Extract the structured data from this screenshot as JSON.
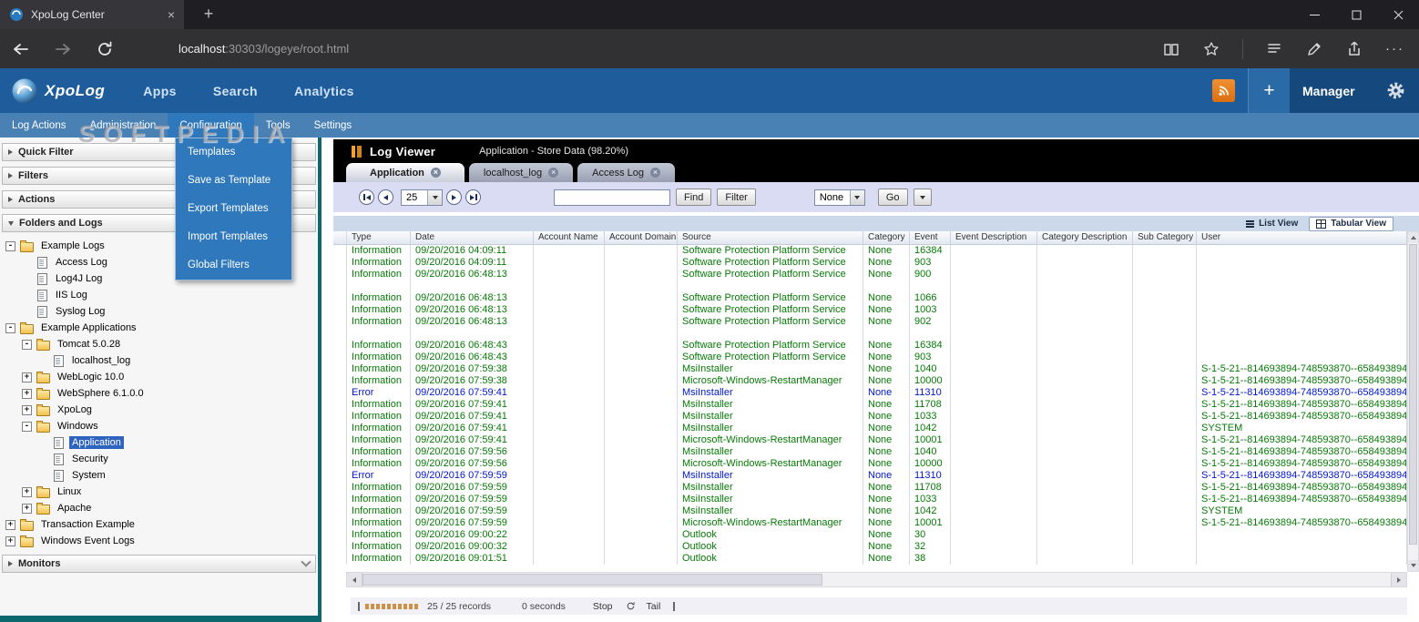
{
  "browser": {
    "tab_title": "XpoLog Center",
    "url_host": "localhost",
    "url_rest": ":30303/logeye/root.html"
  },
  "app_header": {
    "brand": "XpoLog",
    "nav": [
      "Apps",
      "Search",
      "Analytics"
    ],
    "add_label": "+",
    "manager_label": "Manager"
  },
  "menu_bar": {
    "items": [
      "Log Actions",
      "Administration",
      "Configuration",
      "Tools",
      "Settings"
    ],
    "active": "Configuration"
  },
  "config_menu": {
    "items": [
      "Templates",
      "Save as Template",
      "Export Templates",
      "Import Templates",
      "Global Filters"
    ]
  },
  "watermark": "SOFTPEDIA",
  "sidebar": {
    "sections": [
      "Quick Filter",
      "Filters",
      "Actions",
      "Folders and Logs",
      "Monitors"
    ],
    "tree": [
      {
        "label": "Example Logs",
        "level": 0,
        "type": "folder",
        "expander": "minus"
      },
      {
        "label": "Access Log",
        "level": 1,
        "type": "log"
      },
      {
        "label": "Log4J Log",
        "level": 1,
        "type": "log"
      },
      {
        "label": "IIS Log",
        "level": 1,
        "type": "log"
      },
      {
        "label": "Syslog Log",
        "level": 1,
        "type": "log"
      },
      {
        "label": "Example Applications",
        "level": 0,
        "type": "folder",
        "expander": "minus"
      },
      {
        "label": "Tomcat 5.0.28",
        "level": 1,
        "type": "folder",
        "expander": "minus"
      },
      {
        "label": "localhost_log",
        "level": 2,
        "type": "log"
      },
      {
        "label": "WebLogic 10.0",
        "level": 1,
        "type": "folder",
        "expander": "plus"
      },
      {
        "label": "WebSphere 6.1.0.0",
        "level": 1,
        "type": "folder",
        "expander": "plus"
      },
      {
        "label": "XpoLog",
        "level": 1,
        "type": "folder",
        "expander": "plus"
      },
      {
        "label": "Windows",
        "level": 1,
        "type": "folder",
        "expander": "minus"
      },
      {
        "label": "Application",
        "level": 2,
        "type": "log",
        "selected": true
      },
      {
        "label": "Security",
        "level": 2,
        "type": "log"
      },
      {
        "label": "System",
        "level": 2,
        "type": "log"
      },
      {
        "label": "Linux",
        "level": 1,
        "type": "folder",
        "expander": "plus"
      },
      {
        "label": "Apache",
        "level": 1,
        "type": "folder",
        "expander": "plus"
      },
      {
        "label": "Transaction Example",
        "level": 0,
        "type": "folder",
        "expander": "plus"
      },
      {
        "label": "Windows Event Logs",
        "level": 0,
        "type": "folder",
        "expander": "plus"
      }
    ]
  },
  "log_viewer": {
    "title": "Log Viewer",
    "subtitle": "Application  - Store Data (98.20%)",
    "tabs": [
      {
        "label": "Application",
        "active": true
      },
      {
        "label": "localhost_log",
        "active": false
      },
      {
        "label": "Access Log",
        "active": false
      }
    ],
    "toolbar": {
      "page_size": "25",
      "find_label": "Find",
      "filter_label": "Filter",
      "filter_select": "None",
      "go_label": "Go"
    },
    "view_toggle": {
      "list": "List View",
      "tabular": "Tabular View"
    },
    "table": {
      "columns": [
        "Type",
        "Date",
        "Account Name",
        "Account Domain",
        "Source",
        "Category",
        "Event",
        "Event Description",
        "Category Description",
        "Sub Category",
        "User"
      ],
      "rows": [
        {
          "sev": "info",
          "cells": [
            "Information",
            "09/20/2016 04:09:11",
            "",
            "",
            "Software Protection Platform Service",
            "None",
            "16384",
            "",
            "",
            "",
            ""
          ]
        },
        {
          "sev": "info",
          "cells": [
            "Information",
            "09/20/2016 04:09:11",
            "",
            "",
            "Software Protection Platform Service",
            "None",
            "903",
            "",
            "",
            "",
            ""
          ]
        },
        {
          "sev": "info",
          "cells": [
            "Information",
            "09/20/2016 06:48:13",
            "",
            "",
            "Software Protection Platform Service",
            "None",
            "900",
            "",
            "",
            "",
            ""
          ]
        },
        {
          "sev": "blank",
          "cells": []
        },
        {
          "sev": "info",
          "cells": [
            "Information",
            "09/20/2016 06:48:13",
            "",
            "",
            "Software Protection Platform Service",
            "None",
            "1066",
            "",
            "",
            "",
            ""
          ]
        },
        {
          "sev": "info",
          "cells": [
            "Information",
            "09/20/2016 06:48:13",
            "",
            "",
            "Software Protection Platform Service",
            "None",
            "1003",
            "",
            "",
            "",
            ""
          ]
        },
        {
          "sev": "info",
          "cells": [
            "Information",
            "09/20/2016 06:48:13",
            "",
            "",
            "Software Protection Platform Service",
            "None",
            "902",
            "",
            "",
            "",
            ""
          ]
        },
        {
          "sev": "blank",
          "cells": []
        },
        {
          "sev": "info",
          "cells": [
            "Information",
            "09/20/2016 06:48:43",
            "",
            "",
            "Software Protection Platform Service",
            "None",
            "16384",
            "",
            "",
            "",
            ""
          ]
        },
        {
          "sev": "info",
          "cells": [
            "Information",
            "09/20/2016 06:48:43",
            "",
            "",
            "Software Protection Platform Service",
            "None",
            "903",
            "",
            "",
            "",
            ""
          ]
        },
        {
          "sev": "info",
          "cells": [
            "Information",
            "09/20/2016 07:59:38",
            "",
            "",
            "MsiInstaller",
            "None",
            "1040",
            "",
            "",
            "",
            "S-1-5-21--814693894-748593870--658493894"
          ]
        },
        {
          "sev": "info",
          "cells": [
            "Information",
            "09/20/2016 07:59:38",
            "",
            "",
            "Microsoft-Windows-RestartManager",
            "None",
            "10000",
            "",
            "",
            "",
            "S-1-5-21--814693894-748593870--658493894"
          ]
        },
        {
          "sev": "error",
          "cells": [
            "Error",
            "09/20/2016 07:59:41",
            "",
            "",
            "MsiInstaller",
            "None",
            "11310",
            "",
            "",
            "",
            "S-1-5-21--814693894-748593870--658493894"
          ]
        },
        {
          "sev": "info",
          "cells": [
            "Information",
            "09/20/2016 07:59:41",
            "",
            "",
            "MsiInstaller",
            "None",
            "11708",
            "",
            "",
            "",
            "S-1-5-21--814693894-748593870--658493894"
          ]
        },
        {
          "sev": "info",
          "cells": [
            "Information",
            "09/20/2016 07:59:41",
            "",
            "",
            "MsiInstaller",
            "None",
            "1033",
            "",
            "",
            "",
            "S-1-5-21--814693894-748593870--658493894"
          ]
        },
        {
          "sev": "info",
          "cells": [
            "Information",
            "09/20/2016 07:59:41",
            "",
            "",
            "MsiInstaller",
            "None",
            "1042",
            "",
            "",
            "",
            "SYSTEM"
          ]
        },
        {
          "sev": "info",
          "cells": [
            "Information",
            "09/20/2016 07:59:41",
            "",
            "",
            "Microsoft-Windows-RestartManager",
            "None",
            "10001",
            "",
            "",
            "",
            "S-1-5-21--814693894-748593870--658493894"
          ]
        },
        {
          "sev": "info",
          "cells": [
            "Information",
            "09/20/2016 07:59:56",
            "",
            "",
            "MsiInstaller",
            "None",
            "1040",
            "",
            "",
            "",
            "S-1-5-21--814693894-748593870--658493894"
          ]
        },
        {
          "sev": "info",
          "cells": [
            "Information",
            "09/20/2016 07:59:56",
            "",
            "",
            "Microsoft-Windows-RestartManager",
            "None",
            "10000",
            "",
            "",
            "",
            "S-1-5-21--814693894-748593870--658493894"
          ]
        },
        {
          "sev": "error",
          "cells": [
            "Error",
            "09/20/2016 07:59:59",
            "",
            "",
            "MsiInstaller",
            "None",
            "11310",
            "",
            "",
            "",
            "S-1-5-21--814693894-748593870--658493894"
          ]
        },
        {
          "sev": "info",
          "cells": [
            "Information",
            "09/20/2016 07:59:59",
            "",
            "",
            "MsiInstaller",
            "None",
            "11708",
            "",
            "",
            "",
            "S-1-5-21--814693894-748593870--658493894"
          ]
        },
        {
          "sev": "info",
          "cells": [
            "Information",
            "09/20/2016 07:59:59",
            "",
            "",
            "MsiInstaller",
            "None",
            "1033",
            "",
            "",
            "",
            "S-1-5-21--814693894-748593870--658493894"
          ]
        },
        {
          "sev": "info",
          "cells": [
            "Information",
            "09/20/2016 07:59:59",
            "",
            "",
            "MsiInstaller",
            "None",
            "1042",
            "",
            "",
            "",
            "SYSTEM"
          ]
        },
        {
          "sev": "info",
          "cells": [
            "Information",
            "09/20/2016 07:59:59",
            "",
            "",
            "Microsoft-Windows-RestartManager",
            "None",
            "10001",
            "",
            "",
            "",
            "S-1-5-21--814693894-748593870--658493894"
          ]
        },
        {
          "sev": "info",
          "cells": [
            "Information",
            "09/20/2016 09:00:22",
            "",
            "",
            "Outlook",
            "None",
            "30",
            "",
            "",
            "",
            ""
          ]
        },
        {
          "sev": "info",
          "cells": [
            "Information",
            "09/20/2016 09:00:32",
            "",
            "",
            "Outlook",
            "None",
            "32",
            "",
            "",
            "",
            ""
          ]
        },
        {
          "sev": "info",
          "cells": [
            "Information",
            "09/20/2016 09:01:51",
            "",
            "",
            "Outlook",
            "None",
            "38",
            "",
            "",
            "",
            ""
          ]
        }
      ]
    },
    "status_bar": {
      "records": "25 / 25 records",
      "time": "0 seconds",
      "stop": "Stop",
      "tail": "Tail"
    }
  },
  "colors": {
    "header_blue": "#1e5c9c",
    "menubar_blue": "#4a81b5",
    "dropdown_blue": "#2e78bb",
    "accent_orange": "#e2751d",
    "info_green": "#077a07",
    "error_blue": "#0016cf",
    "selected_blue": "#2f63c0"
  },
  "icons": {
    "xpolog-logo-icon": "blue swirl circle",
    "favicon": "blue circle",
    "rss-icon": "rss waves",
    "gear-icon": "gear",
    "plus-icon": "+",
    "tab-close-icon": "x-in-circle",
    "folder-icon": "yellow folder",
    "log-file-icon": "document",
    "list-view-icon": "hamburger lines",
    "tabular-view-icon": "grid",
    "refresh-icon": "circular arrow",
    "progress-dot": "orange dash"
  }
}
